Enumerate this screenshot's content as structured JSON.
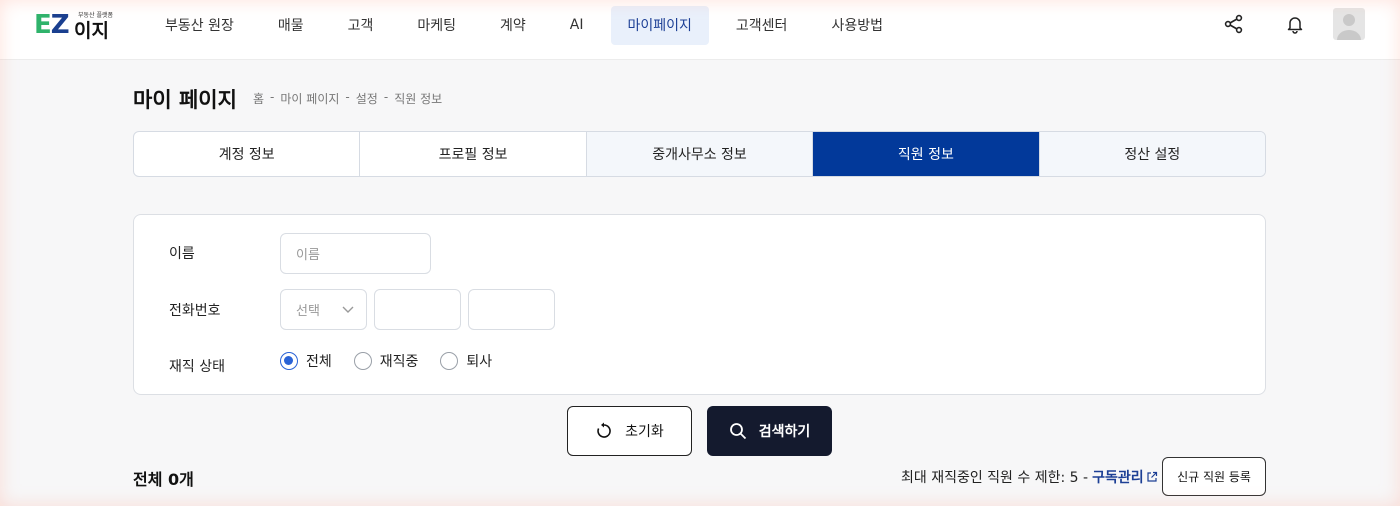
{
  "nav": {
    "logo": {
      "ez_e": "E",
      "ez_z": "Z",
      "ij": "이지",
      "tagline": "부동산 플랫폼"
    },
    "items": [
      {
        "label": "부동산 원장",
        "active": false
      },
      {
        "label": "매물",
        "active": false
      },
      {
        "label": "고객",
        "active": false
      },
      {
        "label": "마케팅",
        "active": false
      },
      {
        "label": "계약",
        "active": false
      },
      {
        "label": "AI",
        "active": false
      },
      {
        "label": "마이페이지",
        "active": true
      },
      {
        "label": "고객센터",
        "active": false
      },
      {
        "label": "사용방법",
        "active": false
      }
    ],
    "icons": [
      "share-icon",
      "bell-icon",
      "avatar"
    ]
  },
  "page": {
    "title": "마이 페이지",
    "breadcrumb": [
      "홈",
      "마이 페이지",
      "설정",
      "직원 정보"
    ],
    "breadcrumb_sep": "-"
  },
  "tabs": [
    {
      "label": "계정 정보",
      "active": false
    },
    {
      "label": "프로필 정보",
      "active": false
    },
    {
      "label": "중개사무소 정보",
      "active": false
    },
    {
      "label": "직원 정보",
      "active": true
    },
    {
      "label": "정산 설정",
      "active": false
    }
  ],
  "search": {
    "name_label": "이름",
    "name_placeholder": "이름",
    "phone_label": "전화번호",
    "phone_select": "선택",
    "status_label": "재직 상태",
    "status_options": [
      {
        "label": "전체",
        "checked": true
      },
      {
        "label": "재직중",
        "checked": false
      },
      {
        "label": "퇴사",
        "checked": false
      }
    ]
  },
  "buttons": {
    "reset": "초기화",
    "search": "검색하기",
    "new_staff": "신규 직원 등록"
  },
  "results": {
    "total": "전체 0개",
    "limit_text": "최대 재직중인 직원 수 제한: 5 -",
    "subscription_link": "구독관리"
  },
  "colors": {
    "primary": "#02399a",
    "dark": "#141a2e",
    "link": "#1c3f95",
    "radio": "#2a63d6"
  }
}
